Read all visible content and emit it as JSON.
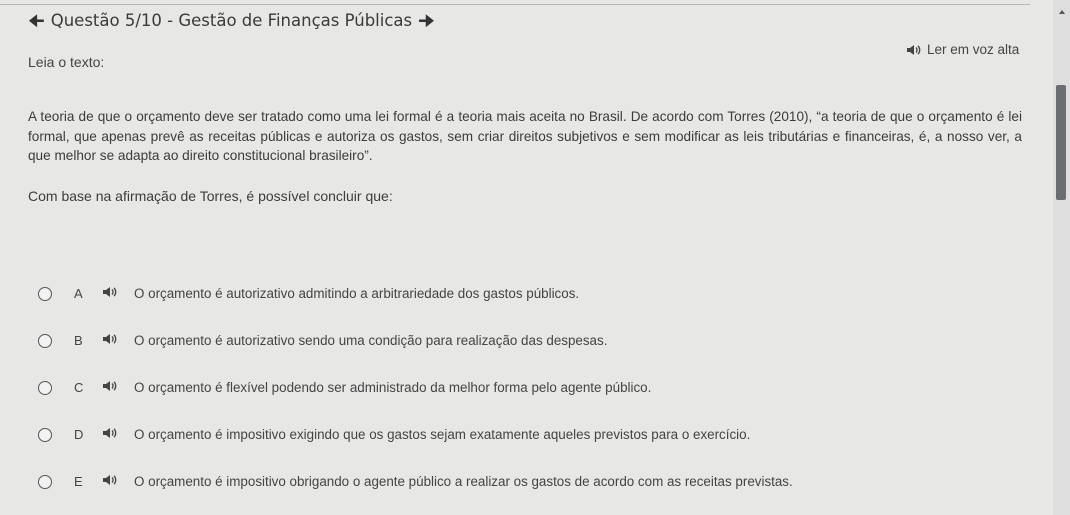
{
  "header": {
    "title": "Questão 5/10 - Gestão de Finanças Públicas"
  },
  "read_label": "Leia o texto:",
  "tts_label": "Ler em voz alta",
  "passage": "A teoria de que o orçamento deve ser tratado como uma lei formal é a teoria mais aceita no Brasil. De acordo com Torres (2010), “a teoria de que o orçamento é lei formal, que apenas prevê as receitas públicas e autoriza os gastos, sem criar direitos subjetivos e sem modificar as leis tributárias e financeiras, é, a nosso ver, a que melhor se adapta ao direito constitucional brasileiro”.",
  "question": "Com base na afirmação de Torres, é possível concluir que:",
  "options": [
    {
      "letter": "A",
      "text": "O orçamento é autorizativo admitindo a arbitrariedade dos gastos públicos."
    },
    {
      "letter": "B",
      "text": "O orçamento é autorizativo sendo uma condição para realização das despesas."
    },
    {
      "letter": "C",
      "text": "O orçamento é flexível podendo ser administrado da melhor forma pelo agente público."
    },
    {
      "letter": "D",
      "text": "O orçamento é impositivo exigindo que os gastos sejam exatamente aqueles previstos para o exercício."
    },
    {
      "letter": "E",
      "text": "O orçamento é impositivo obrigando o agente público a realizar os gastos de acordo com as receitas previstas."
    }
  ],
  "icons": {
    "back": "arrow-left-icon",
    "forward": "arrow-right-icon",
    "speaker": "speaker-icon"
  }
}
